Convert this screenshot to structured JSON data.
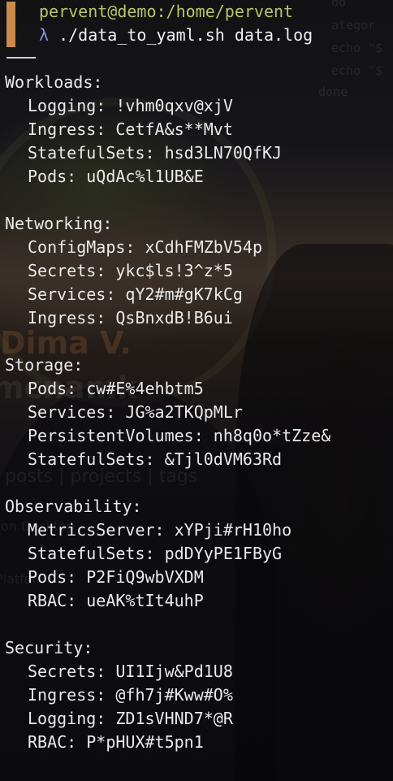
{
  "prompt": {
    "user_host": "pervent@demo",
    "separator": ":",
    "path": "/home/pervent",
    "lambda": "λ",
    "command": "./data_to_yaml.sh data.log"
  },
  "background": {
    "name_text": "Dima V.",
    "sub_text": "mcnamk",
    "links_text": "posts | projects | tags",
    "work_text": "rk on Desktop",
    "platform_text": "Platfor",
    "code_lines": [
      "do",
      "ategor",
      "echo \"$",
      "echo \"$",
      "done"
    ]
  },
  "sections": [
    {
      "title": "Workloads:",
      "items": [
        "Logging: !vhm0qxv@xjV",
        "Ingress: CetfA&s**Mvt",
        "StatefulSets: hsd3LN70QfKJ",
        "Pods: uQdAc%l1UB&E"
      ]
    },
    {
      "title": "Networking:",
      "items": [
        "ConfigMaps: xCdhFMZbV54p",
        "Secrets: ykc$ls!3^z*5",
        "Services: qY2#m#gK7kCg",
        "Ingress: QsBnxdB!B6ui"
      ]
    },
    {
      "title": "Storage:",
      "items": [
        "Pods: cw#E%4ehbtm5",
        "Services: JG%a2TKQpMLr",
        "PersistentVolumes: nh8q0o*tZze&",
        "StatefulSets: &Tjl0dVM63Rd"
      ]
    },
    {
      "title": "Observability:",
      "items": [
        "MetricsServer: xYPji#rH10ho",
        "StatefulSets: pdDYyPE1FByG",
        "Pods: P2FiQ9wbVXDM",
        "RBAC: ueAK%tIt4uhP"
      ]
    },
    {
      "title": "Security:",
      "items": [
        "Secrets: UI1Ijw&Pd1U8",
        "Ingress: @fh7j#Kww#O%",
        "Logging: ZD1sVHND7*@R",
        "RBAC: P*pHUX#t5pn1"
      ]
    }
  ]
}
